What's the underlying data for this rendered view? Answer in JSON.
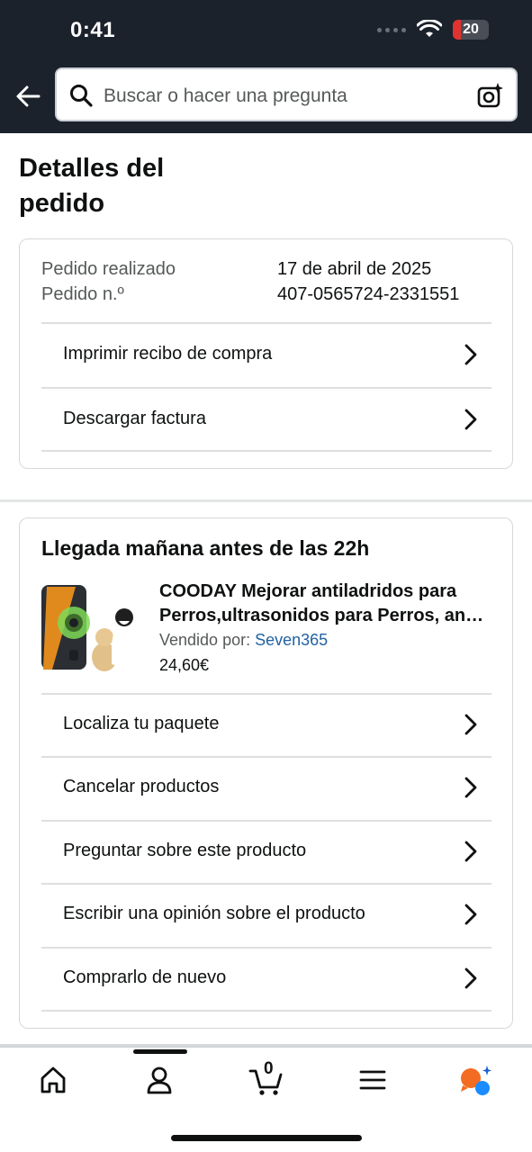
{
  "status_bar": {
    "time": "0:41",
    "battery": "20"
  },
  "search": {
    "placeholder": "Buscar o hacer una pregunta"
  },
  "page": {
    "title_line1": "Detalles del",
    "title_line2": "pedido"
  },
  "order": {
    "placed_label": "Pedido realizado",
    "placed_value": "17 de abril de 2025",
    "number_label": "Pedido n.º",
    "number_value": "407-0565724-2331551",
    "actions": [
      "Imprimir recibo de compra",
      "Descargar factura"
    ]
  },
  "shipment": {
    "arrival": "Llegada mañana antes de las 22h",
    "product_title": "COODAY Mejorar antiladridos para Perros,ultrasonidos para Perros, an…",
    "sold_by_label": "Vendido por:",
    "seller": "Seven365",
    "price": "24,60€",
    "actions": [
      "Localiza tu paquete",
      "Cancelar productos",
      "Preguntar sobre este producto",
      "Escribir una opinión sobre el producto",
      "Comprarlo de nuevo"
    ]
  },
  "tabbar": {
    "cart_count": "0",
    "icons": [
      "home-icon",
      "account-icon",
      "cart-icon",
      "menu-icon",
      "rufus-icon"
    ]
  },
  "colors": {
    "header_bg": "#1b222c",
    "link": "#2162a1",
    "rufus_orange": "#f36c21",
    "rufus_blue": "#1a8cff"
  }
}
